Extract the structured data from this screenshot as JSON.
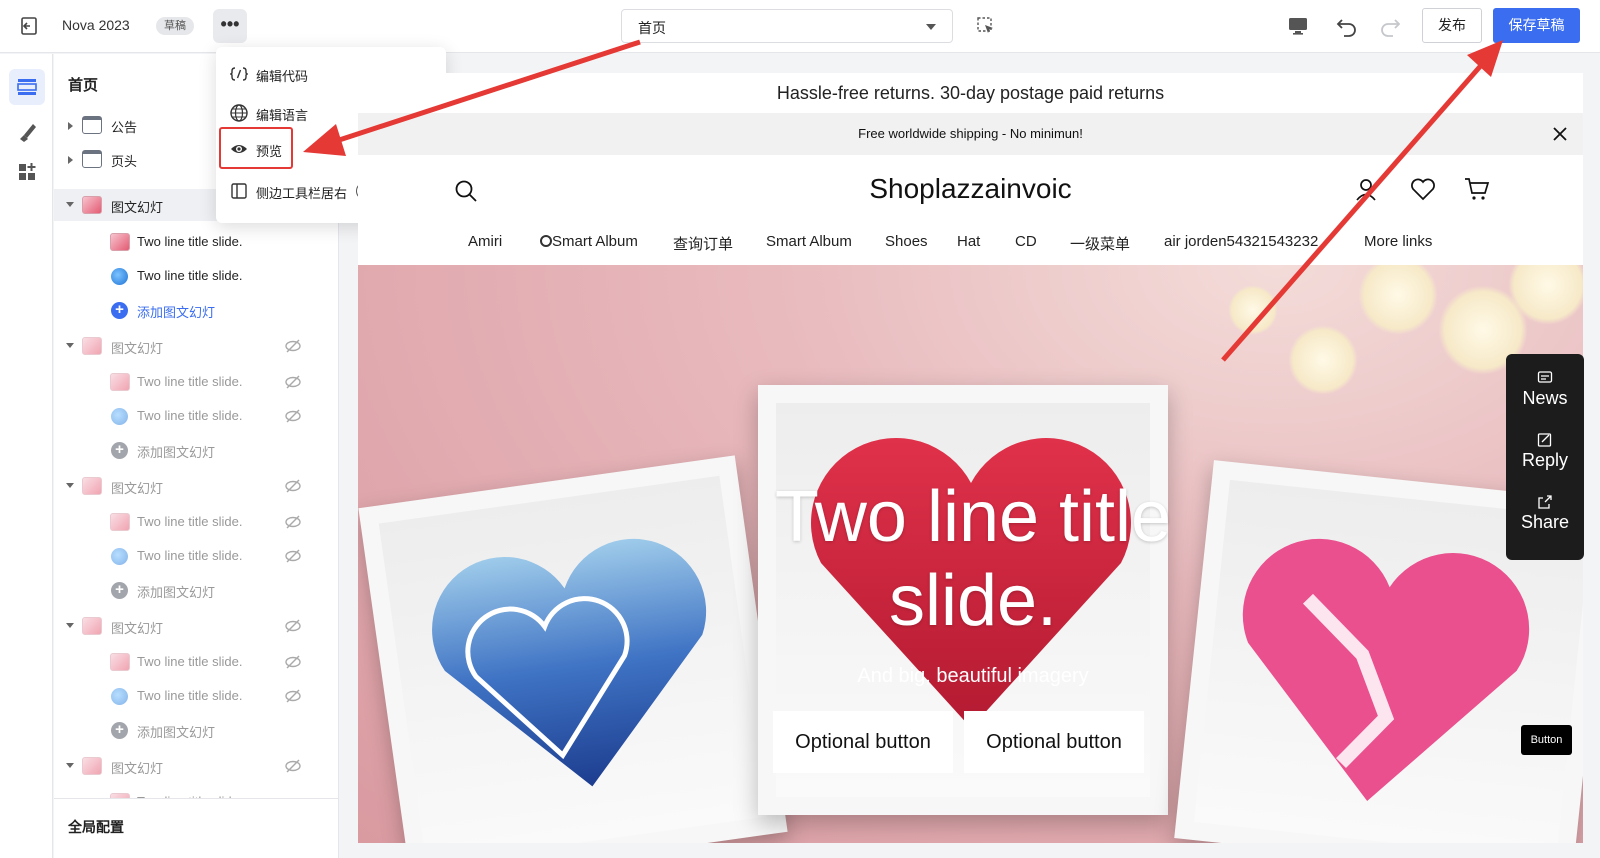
{
  "topbar": {
    "store_name": "Nova 2023",
    "badge": "草稿",
    "more_label": "•••",
    "page_select": "首页",
    "publish_label": "发布",
    "save_draft_label": "保存草稿"
  },
  "dropdown": {
    "items": [
      {
        "label": "编辑代码",
        "icon": "code-icon"
      },
      {
        "label": "编辑语言",
        "icon": "globe-icon"
      },
      {
        "label": "预览",
        "icon": "eye-icon"
      },
      {
        "label": "侧边工具栏居右",
        "icon": "sidebar-icon"
      }
    ],
    "help": "?"
  },
  "sidebar": {
    "title": "首页",
    "rows": [
      {
        "label": "公告",
        "type": "section"
      },
      {
        "label": "页头",
        "type": "section"
      },
      {
        "label": "图文幻灯",
        "type": "group"
      },
      {
        "label": "Two line title slide.",
        "type": "slide"
      },
      {
        "label": "Two line title slide.",
        "type": "slide-globe"
      },
      {
        "label": "添加图文幻灯",
        "type": "add"
      },
      {
        "label": "图文幻灯",
        "type": "group"
      },
      {
        "label": "Two line title slide.",
        "type": "slide"
      },
      {
        "label": "Two line title slide.",
        "type": "slide-globe"
      },
      {
        "label": "添加图文幻灯",
        "type": "add"
      },
      {
        "label": "图文幻灯",
        "type": "group"
      },
      {
        "label": "Two line title slide.",
        "type": "slide"
      },
      {
        "label": "Two line title slide.",
        "type": "slide-globe"
      },
      {
        "label": "添加图文幻灯",
        "type": "add"
      },
      {
        "label": "图文幻灯",
        "type": "group"
      },
      {
        "label": "Two line title slide.",
        "type": "slide"
      },
      {
        "label": "Two line title slide.",
        "type": "slide-globe"
      },
      {
        "label": "添加图文幻灯",
        "type": "add"
      },
      {
        "label": "图文幻灯",
        "type": "group"
      },
      {
        "label": "Two line title slide.",
        "type": "slide"
      }
    ],
    "footer": "全局配置"
  },
  "store": {
    "announcement": "Hassle-free returns. 30-day postage paid returns",
    "shipping": "Free worldwide shipping - No minimun!",
    "logo": "Shoplazzainvoic",
    "nav": [
      "Amiri",
      "Smart Album",
      "查询订单",
      "Smart Album",
      "Shoes",
      "Hat",
      "CD",
      "一级菜单",
      "air jorden54321543232",
      "More links"
    ],
    "hero_title": "Two line title slide.",
    "hero_subtitle": "And big, beautiful imagery",
    "hero_button_1": "Optional button",
    "hero_button_2": "Optional button"
  },
  "dock": {
    "items": [
      {
        "label": "News",
        "icon": "message-icon"
      },
      {
        "label": "Reply",
        "icon": "edit-icon"
      },
      {
        "label": "Share",
        "icon": "share-icon"
      }
    ]
  },
  "floating_button": "Button",
  "colors": {
    "primary": "#3a6df0",
    "annotation_red": "#e53935"
  }
}
